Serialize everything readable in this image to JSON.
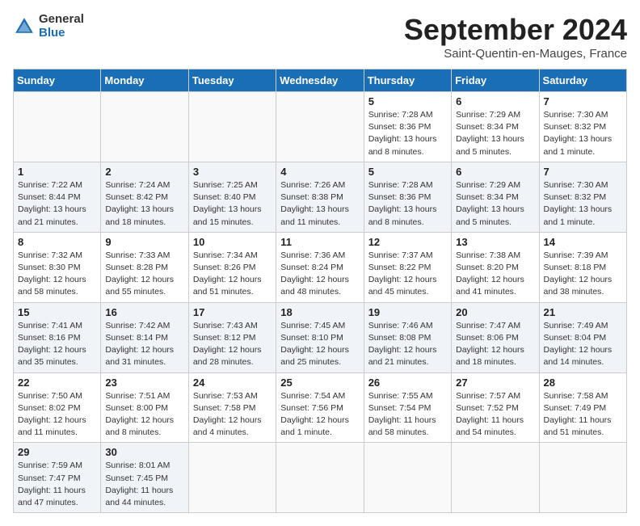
{
  "logo": {
    "general": "General",
    "blue": "Blue"
  },
  "header": {
    "title": "September 2024",
    "subtitle": "Saint-Quentin-en-Mauges, France"
  },
  "calendar": {
    "days_of_week": [
      "Sunday",
      "Monday",
      "Tuesday",
      "Wednesday",
      "Thursday",
      "Friday",
      "Saturday"
    ],
    "weeks": [
      [
        {
          "day": null,
          "info": null
        },
        {
          "day": null,
          "info": null
        },
        {
          "day": null,
          "info": null
        },
        {
          "day": null,
          "info": null
        },
        {
          "day": "5",
          "info": "Sunrise: 7:28 AM\nSunset: 8:36 PM\nDaylight: 13 hours\nand 8 minutes."
        },
        {
          "day": "6",
          "info": "Sunrise: 7:29 AM\nSunset: 8:34 PM\nDaylight: 13 hours\nand 5 minutes."
        },
        {
          "day": "7",
          "info": "Sunrise: 7:30 AM\nSunset: 8:32 PM\nDaylight: 13 hours\nand 1 minute."
        }
      ],
      [
        {
          "day": "1",
          "info": "Sunrise: 7:22 AM\nSunset: 8:44 PM\nDaylight: 13 hours\nand 21 minutes."
        },
        {
          "day": "2",
          "info": "Sunrise: 7:24 AM\nSunset: 8:42 PM\nDaylight: 13 hours\nand 18 minutes."
        },
        {
          "day": "3",
          "info": "Sunrise: 7:25 AM\nSunset: 8:40 PM\nDaylight: 13 hours\nand 15 minutes."
        },
        {
          "day": "4",
          "info": "Sunrise: 7:26 AM\nSunset: 8:38 PM\nDaylight: 13 hours\nand 11 minutes."
        },
        {
          "day": "5",
          "info": "Sunrise: 7:28 AM\nSunset: 8:36 PM\nDaylight: 13 hours\nand 8 minutes."
        },
        {
          "day": "6",
          "info": "Sunrise: 7:29 AM\nSunset: 8:34 PM\nDaylight: 13 hours\nand 5 minutes."
        },
        {
          "day": "7",
          "info": "Sunrise: 7:30 AM\nSunset: 8:32 PM\nDaylight: 13 hours\nand 1 minute."
        }
      ],
      [
        {
          "day": "8",
          "info": "Sunrise: 7:32 AM\nSunset: 8:30 PM\nDaylight: 12 hours\nand 58 minutes."
        },
        {
          "day": "9",
          "info": "Sunrise: 7:33 AM\nSunset: 8:28 PM\nDaylight: 12 hours\nand 55 minutes."
        },
        {
          "day": "10",
          "info": "Sunrise: 7:34 AM\nSunset: 8:26 PM\nDaylight: 12 hours\nand 51 minutes."
        },
        {
          "day": "11",
          "info": "Sunrise: 7:36 AM\nSunset: 8:24 PM\nDaylight: 12 hours\nand 48 minutes."
        },
        {
          "day": "12",
          "info": "Sunrise: 7:37 AM\nSunset: 8:22 PM\nDaylight: 12 hours\nand 45 minutes."
        },
        {
          "day": "13",
          "info": "Sunrise: 7:38 AM\nSunset: 8:20 PM\nDaylight: 12 hours\nand 41 minutes."
        },
        {
          "day": "14",
          "info": "Sunrise: 7:39 AM\nSunset: 8:18 PM\nDaylight: 12 hours\nand 38 minutes."
        }
      ],
      [
        {
          "day": "15",
          "info": "Sunrise: 7:41 AM\nSunset: 8:16 PM\nDaylight: 12 hours\nand 35 minutes."
        },
        {
          "day": "16",
          "info": "Sunrise: 7:42 AM\nSunset: 8:14 PM\nDaylight: 12 hours\nand 31 minutes."
        },
        {
          "day": "17",
          "info": "Sunrise: 7:43 AM\nSunset: 8:12 PM\nDaylight: 12 hours\nand 28 minutes."
        },
        {
          "day": "18",
          "info": "Sunrise: 7:45 AM\nSunset: 8:10 PM\nDaylight: 12 hours\nand 25 minutes."
        },
        {
          "day": "19",
          "info": "Sunrise: 7:46 AM\nSunset: 8:08 PM\nDaylight: 12 hours\nand 21 minutes."
        },
        {
          "day": "20",
          "info": "Sunrise: 7:47 AM\nSunset: 8:06 PM\nDaylight: 12 hours\nand 18 minutes."
        },
        {
          "day": "21",
          "info": "Sunrise: 7:49 AM\nSunset: 8:04 PM\nDaylight: 12 hours\nand 14 minutes."
        }
      ],
      [
        {
          "day": "22",
          "info": "Sunrise: 7:50 AM\nSunset: 8:02 PM\nDaylight: 12 hours\nand 11 minutes."
        },
        {
          "day": "23",
          "info": "Sunrise: 7:51 AM\nSunset: 8:00 PM\nDaylight: 12 hours\nand 8 minutes."
        },
        {
          "day": "24",
          "info": "Sunrise: 7:53 AM\nSunset: 7:58 PM\nDaylight: 12 hours\nand 4 minutes."
        },
        {
          "day": "25",
          "info": "Sunrise: 7:54 AM\nSunset: 7:56 PM\nDaylight: 12 hours\nand 1 minute."
        },
        {
          "day": "26",
          "info": "Sunrise: 7:55 AM\nSunset: 7:54 PM\nDaylight: 11 hours\nand 58 minutes."
        },
        {
          "day": "27",
          "info": "Sunrise: 7:57 AM\nSunset: 7:52 PM\nDaylight: 11 hours\nand 54 minutes."
        },
        {
          "day": "28",
          "info": "Sunrise: 7:58 AM\nSunset: 7:49 PM\nDaylight: 11 hours\nand 51 minutes."
        }
      ],
      [
        {
          "day": "29",
          "info": "Sunrise: 7:59 AM\nSunset: 7:47 PM\nDaylight: 11 hours\nand 47 minutes."
        },
        {
          "day": "30",
          "info": "Sunrise: 8:01 AM\nSunset: 7:45 PM\nDaylight: 11 hours\nand 44 minutes."
        },
        {
          "day": null,
          "info": null
        },
        {
          "day": null,
          "info": null
        },
        {
          "day": null,
          "info": null
        },
        {
          "day": null,
          "info": null
        },
        {
          "day": null,
          "info": null
        }
      ]
    ]
  }
}
